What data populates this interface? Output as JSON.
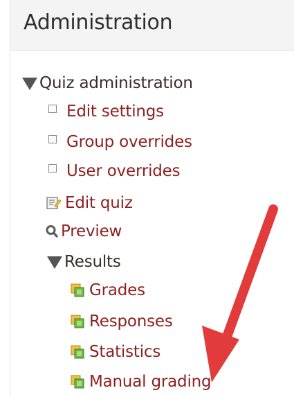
{
  "panel": {
    "title": "Administration"
  },
  "tree": {
    "quiz_admin": {
      "label": "Quiz administration",
      "icon": "expanded-triangle-icon"
    },
    "edit_settings": {
      "label": "Edit settings",
      "icon": "square-bullet-icon"
    },
    "group_overrides": {
      "label": "Group overrides",
      "icon": "square-bullet-icon"
    },
    "user_overrides": {
      "label": "User overrides",
      "icon": "square-bullet-icon"
    },
    "edit_quiz": {
      "label": "Edit quiz",
      "icon": "edit-document-icon"
    },
    "preview": {
      "label": "Preview",
      "icon": "magnifier-icon"
    },
    "results": {
      "label": "Results",
      "icon": "expanded-triangle-icon"
    },
    "grades": {
      "label": "Grades",
      "icon": "report-icon"
    },
    "responses": {
      "label": "Responses",
      "icon": "report-icon"
    },
    "statistics": {
      "label": "Statistics",
      "icon": "report-icon"
    },
    "manual_grading": {
      "label": "Manual grading",
      "icon": "report-icon"
    }
  },
  "annotation": {
    "arrow_color": "#e23b3b"
  },
  "colors": {
    "link": "#8e1f1f",
    "header_bg": "#f4f4f4"
  }
}
